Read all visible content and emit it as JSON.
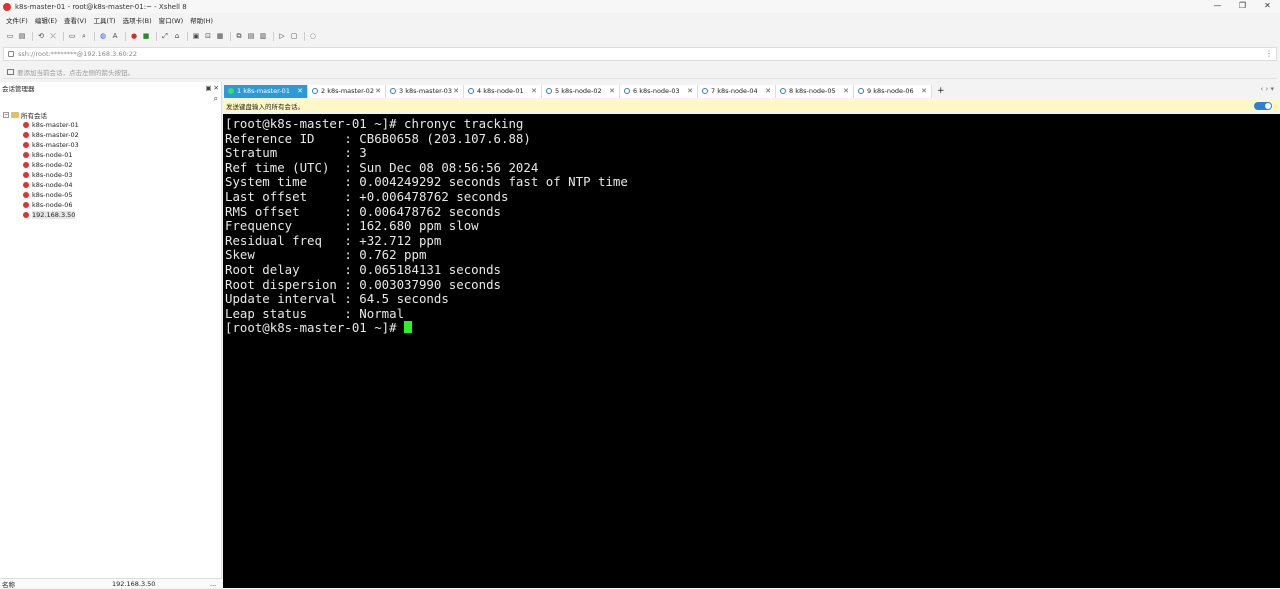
{
  "window": {
    "title": "k8s-master-01 - root@k8s-master-01:~ - Xshell 8",
    "controls": [
      "—",
      "❐",
      "✕"
    ]
  },
  "menu": [
    "文件(F)",
    "编辑(E)",
    "查看(V)",
    "工具(T)",
    "选项卡(B)",
    "窗口(W)",
    "帮助(H)"
  ],
  "address": {
    "text": "ssh://root:********@192.168.3.60:22",
    "more": "⋮"
  },
  "hint": {
    "text": "要添加当前会话，点击左侧的箭头按钮。"
  },
  "sidebar": {
    "title": "会话管理器",
    "pin": "▣",
    "close": "✕",
    "search_icon": "⌕",
    "root_expander": "−",
    "root_label": "所有会话",
    "items": [
      "k8s-master-01",
      "k8s-master-02",
      "k8s-master-03",
      "k8s-node-01",
      "k8s-node-02",
      "k8s-node-03",
      "k8s-node-04",
      "k8s-node-05",
      "k8s-node-06",
      "192.168.3.50"
    ],
    "footer": {
      "name_label": "名称",
      "name_value": "192.168.3.50",
      "more": "..."
    }
  },
  "tabs": [
    {
      "label": "1 k8s-master-01"
    },
    {
      "label": "2 k8s-master-02"
    },
    {
      "label": "3 k8s-master-03"
    },
    {
      "label": "4 k8s-node-01"
    },
    {
      "label": "5 k8s-node-02"
    },
    {
      "label": "6 k8s-node-03"
    },
    {
      "label": "7 k8s-node-04"
    },
    {
      "label": "8 k8s-node-05"
    },
    {
      "label": "9 k8s-node-06"
    }
  ],
  "tab_add": "+",
  "tab_nav": "‹  ›  ▾",
  "infobar": {
    "text": "发送键盘输入的所有会话。"
  },
  "terminal": {
    "lines": [
      "[root@k8s-master-01 ~]# chronyc tracking",
      "Reference ID    : CB6B0658 (203.107.6.88)",
      "Stratum         : 3",
      "Ref time (UTC)  : Sun Dec 08 08:56:56 2024",
      "System time     : 0.004249292 seconds fast of NTP time",
      "Last offset     : +0.006478762 seconds",
      "RMS offset      : 0.006478762 seconds",
      "Frequency       : 162.680 ppm slow",
      "Residual freq   : +32.712 ppm",
      "Skew            : 0.762 ppm",
      "Root delay      : 0.065184131 seconds",
      "Root dispersion : 0.003037990 seconds",
      "Update interval : 64.5 seconds",
      "Leap status     : Normal"
    ],
    "prompt": "[root@k8s-master-01 ~]# "
  }
}
